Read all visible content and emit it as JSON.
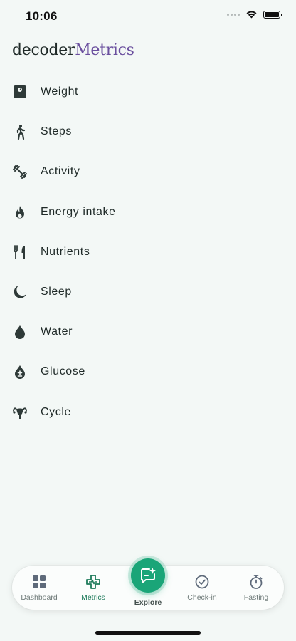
{
  "status_bar": {
    "time": "10:06"
  },
  "brand": {
    "part1": "decoder",
    "part2": "Metrics"
  },
  "metrics": [
    {
      "label": "Weight",
      "icon": "scale-icon"
    },
    {
      "label": "Steps",
      "icon": "walking-icon"
    },
    {
      "label": "Activity",
      "icon": "dumbbell-icon"
    },
    {
      "label": "Energy intake",
      "icon": "flame-icon"
    },
    {
      "label": "Nutrients",
      "icon": "fork-knife-icon"
    },
    {
      "label": "Sleep",
      "icon": "moon-icon"
    },
    {
      "label": "Water",
      "icon": "water-drop-icon"
    },
    {
      "label": "Glucose",
      "icon": "glucose-drop-icon"
    },
    {
      "label": "Cycle",
      "icon": "uterus-icon"
    }
  ],
  "tab_bar": {
    "active": "Metrics",
    "tabs": [
      {
        "label": "Dashboard",
        "icon": "grid-icon"
      },
      {
        "label": "Metrics",
        "icon": "health-cross-icon"
      },
      {
        "label": "Explore",
        "icon": "chat-sparkle-icon"
      },
      {
        "label": "Check-in",
        "icon": "check-circle-icon"
      },
      {
        "label": "Fasting",
        "icon": "stopwatch-icon"
      }
    ]
  },
  "colors": {
    "background": "#f3f8f6",
    "brand_accent": "#6a4f9e",
    "active_green": "#1d7a5a",
    "explore_green": "#1aa578"
  }
}
